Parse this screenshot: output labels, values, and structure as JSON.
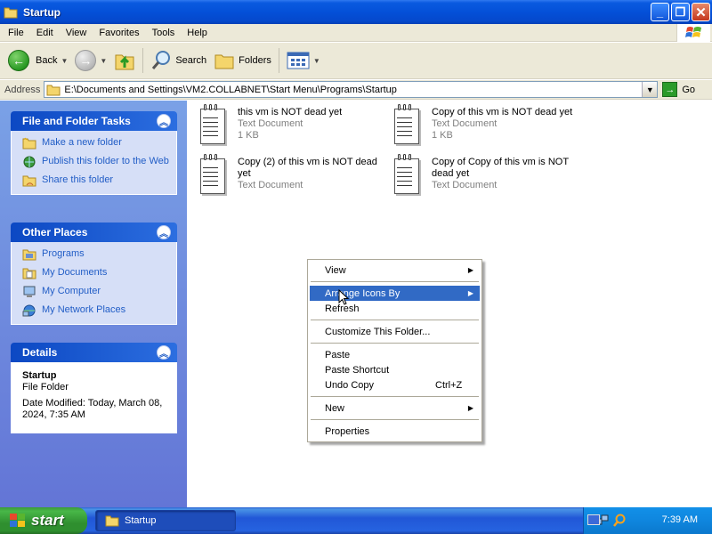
{
  "window": {
    "title": "Startup"
  },
  "menubar": {
    "items": [
      "File",
      "Edit",
      "View",
      "Favorites",
      "Tools",
      "Help"
    ]
  },
  "toolbar": {
    "back_label": "Back",
    "search_label": "Search",
    "folders_label": "Folders"
  },
  "address": {
    "label": "Address",
    "value": "E:\\Documents and Settings\\VM2.COLLABNET\\Start Menu\\Programs\\Startup",
    "go_label": "Go"
  },
  "tasks_panel": {
    "title": "File and Folder Tasks",
    "links": [
      "Make a new folder",
      "Publish this folder to the Web",
      "Share this folder"
    ]
  },
  "places_panel": {
    "title": "Other Places",
    "links": [
      "Programs",
      "My Documents",
      "My Computer",
      "My Network Places"
    ]
  },
  "details_panel": {
    "title": "Details",
    "name": "Startup",
    "type": "File Folder",
    "modified": "Date Modified: Today, March 08, 2024, 7:35 AM"
  },
  "files": [
    {
      "name": "this vm is NOT dead yet",
      "type": "Text Document",
      "size": "1 KB"
    },
    {
      "name": "Copy of this vm is NOT dead yet",
      "type": "Text Document",
      "size": "1 KB"
    },
    {
      "name": "Copy (2) of this vm is NOT dead yet",
      "type": "Text Document",
      "size": ""
    },
    {
      "name": "Copy of Copy of this vm is NOT dead yet",
      "type": "Text Document",
      "size": ""
    }
  ],
  "context_menu": {
    "view": "View",
    "arrange": "Arrange Icons By",
    "refresh": "Refresh",
    "customize": "Customize This Folder...",
    "paste": "Paste",
    "paste_shortcut": "Paste Shortcut",
    "undo_copy": "Undo Copy",
    "undo_copy_shortcut": "Ctrl+Z",
    "new": "New",
    "properties": "Properties"
  },
  "taskbar": {
    "start_label": "start",
    "task_label": "Startup",
    "clock": "7:39 AM"
  },
  "colors": {
    "title_blue": "#0450d8",
    "left_pane": "#6f8ee0",
    "link_blue": "#215dc6",
    "menu_highlight": "#316ac5",
    "start_green": "#2f8f2f"
  }
}
